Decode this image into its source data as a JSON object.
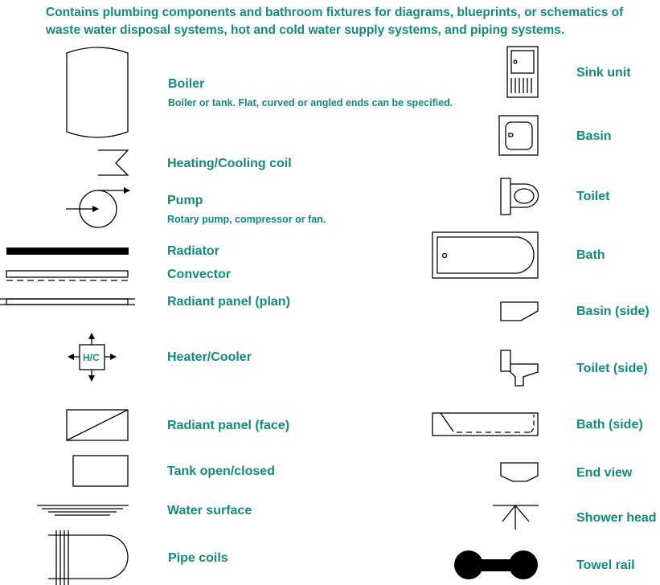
{
  "description": "Contains plumbing components and bathroom fixtures for diagrams, blueprints, or schematics of waste water disposal systems, hot and cold water supply systems, and piping systems.",
  "accent_color": "#138a7a",
  "left_items": [
    {
      "label": "Boiler",
      "desc": "Boiler or tank. Flat, curved or angled ends can be specified.",
      "icon": "boiler-icon"
    },
    {
      "label": "Heating/Cooling coil",
      "icon": "heating-cooling-coil-icon"
    },
    {
      "label": "Pump",
      "desc": "Rotary pump, compressor or fan.",
      "icon": "pump-icon"
    },
    {
      "label": "Radiator",
      "icon": "radiator-icon"
    },
    {
      "label": "Convector",
      "icon": "convector-icon"
    },
    {
      "label": "Radiant panel (plan)",
      "icon": "radiant-panel-plan-icon"
    },
    {
      "label": "Heater/Cooler",
      "icon": "heater-cooler-icon",
      "icon_text": "H/C"
    },
    {
      "label": "Radiant panel (face)",
      "icon": "radiant-panel-face-icon"
    },
    {
      "label": "Tank open/closed",
      "icon": "tank-icon"
    },
    {
      "label": "Water surface",
      "icon": "water-surface-icon"
    },
    {
      "label": "Pipe coils",
      "icon": "pipe-coils-icon"
    }
  ],
  "right_items": [
    {
      "label": "Sink unit",
      "icon": "sink-unit-icon"
    },
    {
      "label": "Basin",
      "icon": "basin-icon"
    },
    {
      "label": "Toilet",
      "icon": "toilet-icon"
    },
    {
      "label": "Bath",
      "icon": "bath-icon"
    },
    {
      "label": "Basin (side)",
      "icon": "basin-side-icon"
    },
    {
      "label": "Toilet (side)",
      "icon": "toilet-side-icon"
    },
    {
      "label": "Bath (side)",
      "icon": "bath-side-icon"
    },
    {
      "label": "End view",
      "icon": "end-view-icon"
    },
    {
      "label": "Shower head",
      "icon": "shower-head-icon"
    },
    {
      "label": "Towel rail",
      "icon": "towel-rail-icon"
    }
  ]
}
